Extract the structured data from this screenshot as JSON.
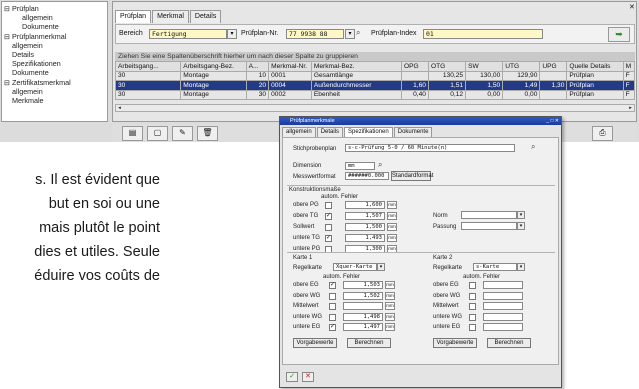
{
  "tree": {
    "items": [
      {
        "label": "Prüfplan",
        "level": 0,
        "toggle": "⊟"
      },
      {
        "label": "allgemein",
        "level": 2
      },
      {
        "label": "Dokumente",
        "level": 2
      },
      {
        "label": "Prüfplanmerkmal",
        "level": 0,
        "toggle": "⊟"
      },
      {
        "label": "allgemein",
        "level": 1
      },
      {
        "label": "Details",
        "level": 1
      },
      {
        "label": "Spezifikationen",
        "level": 1
      },
      {
        "label": "Dokumente",
        "level": 1
      },
      {
        "label": "Zertifikatsmerkmal",
        "level": 0,
        "toggle": "⊟"
      },
      {
        "label": "allgemein",
        "level": 1
      },
      {
        "label": "Merkmale",
        "level": 1
      }
    ]
  },
  "tabs": [
    "Prüfplan",
    "Merkmal",
    "Details"
  ],
  "filter": {
    "bereich_label": "Bereich",
    "bereich_value": "Fertigung",
    "pruefplan_label": "Prüfplan-Nr.",
    "pruefplan_value": "77 9938 88",
    "index_label": "Prüfplan-Index",
    "index_value": "01"
  },
  "hint": "Ziehen Sie eine Spaltenüberschrift hierher um nach dieser Spalte zu gruppieren",
  "grid": {
    "headers": [
      "Arbeitsgang...",
      "Arbeitsgang-Bez.",
      "A...",
      "Merkmal-Nr.",
      "Merkmal-Bez.",
      "OPG",
      "OTG",
      "SW",
      "UTG",
      "UPG",
      "Quelle Details",
      "M"
    ],
    "rows": [
      [
        "30",
        "Montage",
        "10",
        "0001",
        "Gesamtlänge",
        "",
        "130,25",
        "130,00",
        "129,90",
        "",
        "Prüfplan",
        "F"
      ],
      [
        "30",
        "Montage",
        "20",
        "0004",
        "Außendurchmesser",
        "1,60",
        "1,51",
        "1,50",
        "1,49",
        "1,30",
        "Prüfplan",
        "F"
      ],
      [
        "30",
        "Montage",
        "30",
        "0002",
        "Ebenheit",
        "0,40",
        "0,12",
        "0,00",
        "0,00",
        "",
        "Prüfplan",
        "F"
      ]
    ]
  },
  "paragraph": [
    "s. Il est évident que",
    "but en soi ou une",
    "mais plutôt le point",
    "dies et utiles. Seule",
    "éduire vos coûts de"
  ],
  "dialog": {
    "title": "Prüfplanmerkmale",
    "tabs": [
      "allgemein",
      "Details",
      "Spezifikationen",
      "Dokumente"
    ],
    "stichproben_label": "Stichprobenplan",
    "stichproben_value": "s-c-Prüfung 5-0 / 60 Minute(n)",
    "dimension_label": "Dimension",
    "dimension_value": "mm",
    "messwert_label": "Messwertformat",
    "messwert_value": "######0.000",
    "standard_button": "Standardformat",
    "konstruktion_title": "Konstruktionsmaße",
    "autom_fehler": "autom. Fehler",
    "konstruktion_rows": [
      {
        "label": "obere PG",
        "checked": false,
        "value": "1,600"
      },
      {
        "label": "obere TG",
        "checked": true,
        "value": "1,507"
      },
      {
        "label": "Sollwert",
        "checked": false,
        "value": "1,500"
      },
      {
        "label": "untere TG",
        "checked": true,
        "value": "1,493"
      },
      {
        "label": "untere PG",
        "checked": false,
        "value": "1,300"
      }
    ],
    "unit": "mm",
    "norm_label": "Norm",
    "passung_label": "Passung",
    "karte1": {
      "title": "Karte 1",
      "regelkarte_label": "Regelkarte",
      "regelkarte_value": "Xquer-Karte",
      "autom_fehler": "autom. Fehler",
      "rows": [
        {
          "label": "obere EG",
          "checked": true,
          "value": "1,503"
        },
        {
          "label": "obere WG",
          "checked": false,
          "value": "1,502"
        },
        {
          "label": "Mittelwert",
          "checked": false,
          "value": ""
        },
        {
          "label": "untere WG",
          "checked": false,
          "value": "1,498"
        },
        {
          "label": "untere EG",
          "checked": true,
          "value": "1,497"
        }
      ],
      "btn_vorgabe": "Vorgabewerte",
      "btn_berechnen": "Berechnen"
    },
    "karte2": {
      "title": "Karte 2",
      "regelkarte_label": "Regelkarte",
      "regelkarte_value": "s-Karte",
      "autom_fehler": "autom. Fehler",
      "rows": [
        {
          "label": "obere EG",
          "checked": false,
          "value": ""
        },
        {
          "label": "obere WG",
          "checked": false,
          "value": ""
        },
        {
          "label": "Mittelwert",
          "checked": false,
          "value": ""
        },
        {
          "label": "untere WG",
          "checked": false,
          "value": ""
        },
        {
          "label": "untere EG",
          "checked": false,
          "value": ""
        }
      ],
      "btn_vorgabe": "Vorgabewerte",
      "btn_berechnen": "Berechnen"
    },
    "ok_glyph": "✓",
    "cancel_glyph": "✕"
  },
  "colors": {
    "selection": "#233a86",
    "input_bg": "#fdf8c6",
    "title_bar": "#1b3b98",
    "ok": "#2a8a2a",
    "cancel": "#c62020"
  }
}
